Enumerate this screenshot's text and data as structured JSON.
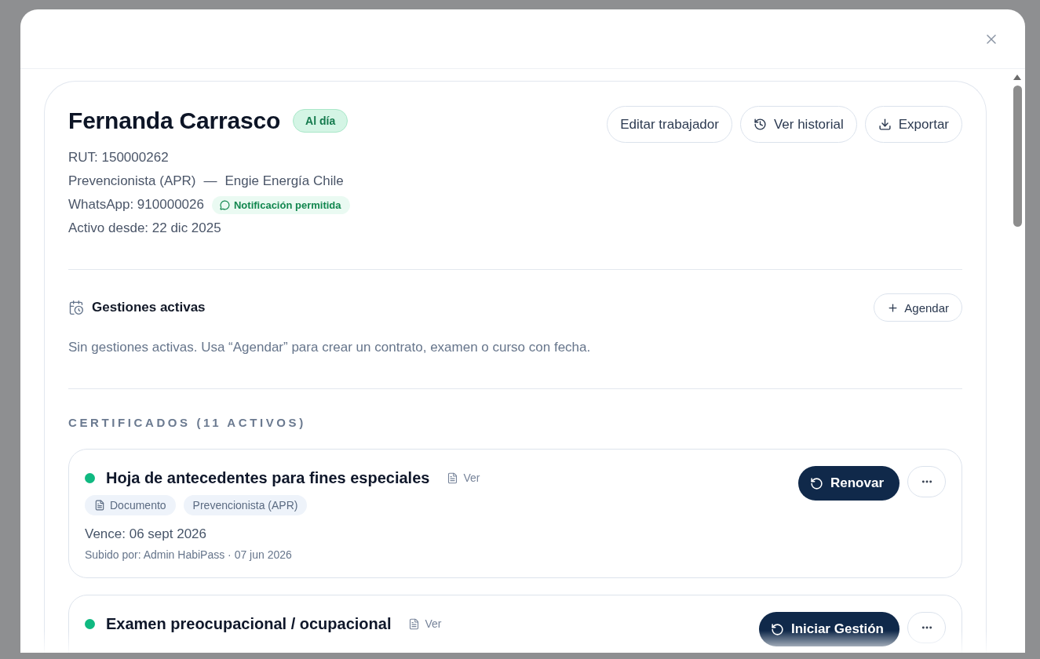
{
  "worker": {
    "name": "Fernanda Carrasco",
    "status": "Al día",
    "rut": "RUT: 150000262",
    "role": "Prevencionista (APR)",
    "separator": "—",
    "company": "Engie Energía Chile",
    "whatsapp": "WhatsApp: 910000026",
    "notification": "Notificación permitida",
    "active_since": "Activo desde: 22 dic 2025"
  },
  "actions": [
    {
      "label": "Editar trabajador",
      "kind": "edit"
    },
    {
      "label": "Ver historial",
      "kind": "history"
    },
    {
      "label": "Exportar",
      "kind": "export"
    }
  ],
  "gestiones": {
    "title": "Gestiones activas",
    "button": "Agendar",
    "empty_text": "Sin gestiones activas. Usa “Agendar” para crear un contrato, examen o curso con fecha."
  },
  "certificates": {
    "heading": "CERTIFICADOS (11 ACTIVOS)",
    "items": [
      {
        "title": "Hoja de antecedentes para fines especiales",
        "link": "Ver",
        "color": "#10b981",
        "tags": [
          {
            "label": "Documento",
            "kind": "type"
          },
          {
            "label": "Prevencionista (APR)",
            "kind": "role"
          }
        ],
        "expires": "Vence: 06 sept 2026",
        "uploaded": "Subido por: Admin HabiPass · 07 jun 2026",
        "action": "Renovar"
      },
      {
        "title": "Examen preocupacional / ocupacional",
        "link": "Ver",
        "color": "#10b981",
        "action": "Iniciar Gestión"
      }
    ]
  }
}
